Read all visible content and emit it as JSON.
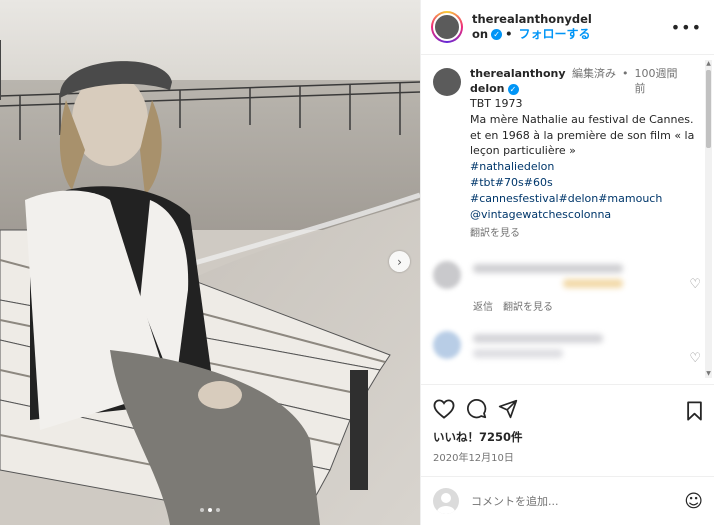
{
  "header": {
    "username": "therealanthonydelon",
    "follow_label": "フォローする",
    "separator": "•",
    "more_icon": "•••"
  },
  "caption": {
    "username": "therealanthonydelon",
    "edited": "編集済み",
    "separator": "•",
    "time_ago": "100週間前",
    "lines": [
      "TBT 1973",
      "Ma mère Nathalie au festival de Cannes.",
      "et en 1968 à la première de son film « la leçon particulière »"
    ],
    "hashtags": [
      "#nathaliedelon",
      "#tbt#70s#60s",
      "#cannesfestival#delon#mamouch",
      "@vintagewatchescolonna"
    ],
    "translate_label": "翻訳を見る"
  },
  "comment_actions": {
    "reply_label": "返信",
    "translate_label": "翻訳を見る"
  },
  "post": {
    "likes_text": "いいね！7250件",
    "date": "2020年12月10日"
  },
  "composer": {
    "placeholder": "コメントを追加...",
    "emoji_icon": "☺"
  },
  "carousel": {
    "next_icon": "›",
    "dot_count": 3,
    "active_dot": 1
  },
  "colors": {
    "accent": "#0095f6",
    "hashtag": "#00376b",
    "muted": "#737373"
  }
}
